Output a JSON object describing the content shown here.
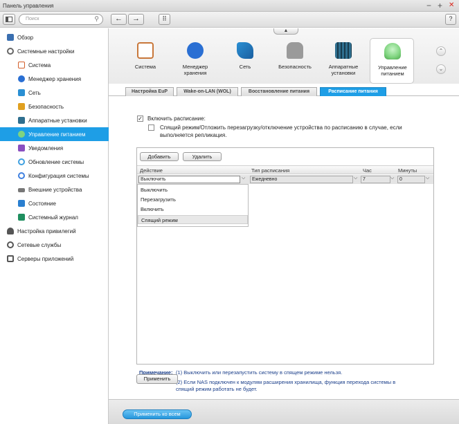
{
  "window": {
    "title": "Панель управления",
    "controls": {
      "minimize": "−",
      "maximize": "+",
      "close": "✕"
    }
  },
  "toolbar": {
    "search_placeholder": "Поиск",
    "back": "←",
    "forward": "→",
    "apps": "⠿",
    "help": "?"
  },
  "sidebar": {
    "items": [
      {
        "label": "Обзор",
        "icon": "overview-icon",
        "level": 0,
        "color": "#3a6fb0"
      },
      {
        "label": "Системные настройки",
        "icon": "system-settings-icon",
        "level": 0,
        "color": "#666666"
      },
      {
        "label": "Система",
        "icon": "system-icon",
        "level": 1,
        "color": "#d35f2a"
      },
      {
        "label": "Менеджер хранения",
        "icon": "storage-icon",
        "level": 1,
        "color": "#2a6fd3"
      },
      {
        "label": "Сеть",
        "icon": "network-icon",
        "level": 1,
        "color": "#2a8fd3"
      },
      {
        "label": "Безопасность",
        "icon": "lock-icon",
        "level": 1,
        "color": "#e0a020"
      },
      {
        "label": "Аппаратные установки",
        "icon": "hardware-icon",
        "level": 1,
        "color": "#2f6f8f"
      },
      {
        "label": "Управление питанием",
        "icon": "power-icon",
        "level": 1,
        "selected": true,
        "color": "#7fd47f"
      },
      {
        "label": "Уведомления",
        "icon": "notification-icon",
        "level": 1,
        "color": "#8a4fc0"
      },
      {
        "label": "Обновление системы",
        "icon": "update-icon",
        "level": 1,
        "color": "#3fa0e0"
      },
      {
        "label": "Конфигурация системы",
        "icon": "config-icon",
        "level": 1,
        "color": "#3f80e0"
      },
      {
        "label": "Внешние устройства",
        "icon": "external-device-icon",
        "level": 1,
        "color": "#555555"
      },
      {
        "label": "Состояние",
        "icon": "status-icon",
        "level": 1,
        "color": "#2a7fd0"
      },
      {
        "label": "Системный журнал",
        "icon": "log-icon",
        "level": 1,
        "color": "#1f8f5f"
      },
      {
        "label": "Настройка привилегий",
        "icon": "privilege-icon",
        "level": 0,
        "color": "#555555"
      },
      {
        "label": "Сетевые службы",
        "icon": "network-services-icon",
        "level": 0,
        "color": "#555555"
      },
      {
        "label": "Серверы приложений",
        "icon": "app-servers-icon",
        "level": 0,
        "color": "#555555"
      }
    ]
  },
  "categories": [
    {
      "label": "Система",
      "icon": "system-icon",
      "color": "#c8773a"
    },
    {
      "label": "Менеджер хранения",
      "icon": "storage-icon",
      "color": "#2a6fd3"
    },
    {
      "label": "Сеть",
      "icon": "network-icon",
      "color": "#2a8fd3"
    },
    {
      "label": "Безопасность",
      "icon": "lock-icon",
      "color": "#9a9a9a"
    },
    {
      "label": "Аппаратные установки",
      "icon": "hardware-icon",
      "color": "#2f6f8f"
    },
    {
      "label": "Управление питанием",
      "icon": "power-icon",
      "color": "#7fd47f",
      "active": true
    }
  ],
  "tabs": [
    {
      "label": "Настройка EuP"
    },
    {
      "label": "Wake-on-LAN (WOL)"
    },
    {
      "label": "Восстановление питания"
    },
    {
      "label": "Расписание питания",
      "active": true
    }
  ],
  "schedule": {
    "enable_label": "Включить расписание:",
    "enable_checked": true,
    "replication_label_line1": "Спящий режим/Отложить перезагрузку/отключение устройства по расписанию в случае, если",
    "replication_label_line2": "выполняется репликация.",
    "replication_checked": false,
    "add_button": "Добавить",
    "delete_button": "Удалить",
    "columns": [
      "Действие",
      "Тип расписания",
      "Час",
      "Минуты"
    ],
    "row": {
      "action": "Выключить",
      "type": "Ежедневно",
      "hour": "7",
      "minute": "0"
    },
    "dropdown_options": [
      "Выключить",
      "Перезагрузить",
      "Включить",
      "Спящий режим"
    ],
    "highlighted_option": "Спящий режим"
  },
  "note": {
    "title": "Примечание:",
    "line1": "(1) Выключить или перезапустить систему в спящем режиме нельзя.",
    "line2": "(2) Если NAS подключен к модулям расширения хранилища, функция перехода системы в",
    "line3": "спящий режим работать не будет."
  },
  "apply_button": "Применить",
  "apply_all_button": "Применить ко всем"
}
